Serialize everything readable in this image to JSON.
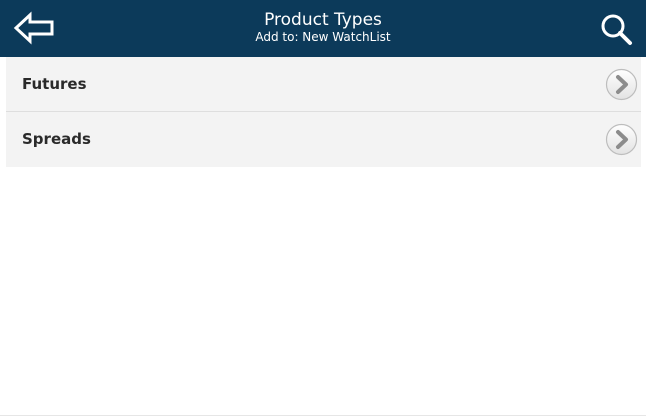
{
  "header": {
    "title": "Product Types",
    "subtitle": "Add to: New WatchList",
    "back_icon": "back-arrow-icon",
    "search_icon": "search-icon",
    "background_color": "#0c3a5a"
  },
  "list": {
    "items": [
      {
        "label": "Futures",
        "icon": "chevron-right-icon"
      },
      {
        "label": "Spreads",
        "icon": "chevron-right-icon"
      }
    ]
  }
}
